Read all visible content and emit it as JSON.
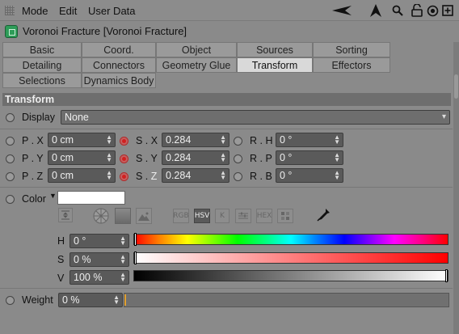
{
  "menubar": {
    "items": [
      "Mode",
      "Edit",
      "User Data"
    ]
  },
  "title": "Voronoi Fracture [Voronoi Fracture]",
  "tabs": {
    "row1": [
      "Basic",
      "Coord.",
      "Object",
      "Sources",
      "Sorting"
    ],
    "row2": [
      "Detailing",
      "Connectors",
      "Geometry Glue",
      "Transform",
      "Effectors"
    ],
    "row3": [
      "Selections",
      "Dynamics Body"
    ],
    "active": "Transform"
  },
  "section": "Transform",
  "display": {
    "label": "Display",
    "value": "None"
  },
  "position": {
    "x": {
      "label": "P . X",
      "value": "0 cm"
    },
    "y": {
      "label": "P . Y",
      "value": "0 cm"
    },
    "z": {
      "label": "P . Z",
      "value": "0 cm"
    }
  },
  "scale": {
    "x": {
      "label": "S . X",
      "value": "0.284"
    },
    "y": {
      "label": "S . Y",
      "value": "0.284"
    },
    "z_prefix": "S . ",
    "z_letter": "Z",
    "z": {
      "value": "0.284"
    }
  },
  "rotation": {
    "h": {
      "label": "R . H",
      "value": "0 °"
    },
    "p": {
      "label": "R . P",
      "value": "0 °"
    },
    "b": {
      "label": "R . B",
      "value": "0 °"
    }
  },
  "color": {
    "label": "Color",
    "swatch": "#ffffff",
    "mode_buttons": [
      "RGB",
      "HSV",
      "K",
      "",
      "HEX",
      ""
    ],
    "active_mode": "HSV",
    "h": {
      "label": "H",
      "value": "0 °"
    },
    "s": {
      "label": "S",
      "value": "0 %"
    },
    "v": {
      "label": "V",
      "value": "100 %"
    }
  },
  "weight": {
    "label": "Weight",
    "value": "0 %"
  },
  "accent_red": "#d02020"
}
